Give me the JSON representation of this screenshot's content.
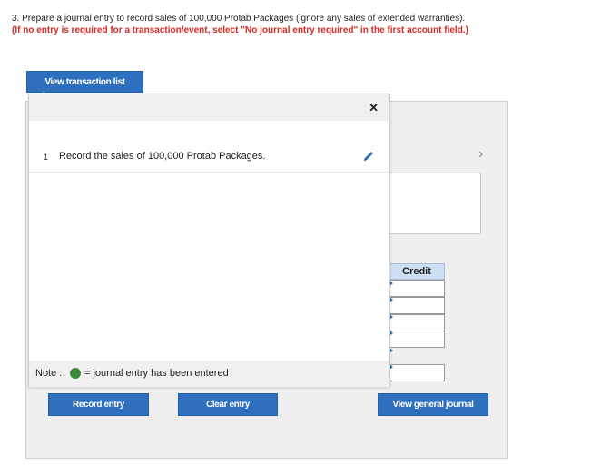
{
  "question": {
    "normal": "3. Prepare a journal entry to record sales of 100,000 Protab Packages (ignore any sales of extended warranties).",
    "emphasis": "(If no entry is required for a transaction/event, select \"No journal entry required\" in the first account field.)"
  },
  "buttons": {
    "view_transaction_list": "View transaction list",
    "record_entry": "Record entry",
    "clear_entry": "Clear entry",
    "view_general_journal": "View general journal"
  },
  "popup": {
    "close": "✕",
    "transaction": {
      "number": "1",
      "text": "Record the sales of 100,000 Protab Packages."
    },
    "note": {
      "label": "Note :",
      "text": "= journal entry has been entered"
    }
  },
  "journal": {
    "credit_header": "Credit",
    "credit_values": [
      "",
      "",
      "",
      "",
      ""
    ]
  },
  "icons": {
    "edit": "pencil-icon",
    "next": "chevron-right-icon",
    "close": "close-icon",
    "entered": "green-dot-icon"
  },
  "colors": {
    "accent": "#2e6fbe",
    "emphasis": "#d42a24",
    "entered": "#3b8a3b"
  }
}
